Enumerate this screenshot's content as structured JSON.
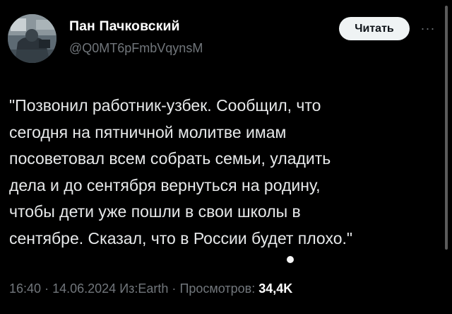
{
  "author": {
    "display_name": "Пан Пачковский",
    "handle": "@Q0MT6pFmbVqynsM",
    "avatar_icon": "profile-photo"
  },
  "actions": {
    "follow_label": "Читать",
    "more_label": "···"
  },
  "tweet": {
    "lines": [
      "\"Позвонил работник-узбек. Сообщил, что",
      "сегодня на пятничной молитве имам",
      "посоветовал всем собрать семьи, уладить",
      "дела и до сентября вернуться на родину,",
      "чтобы дети уже пошли в свои школы в",
      "сентябре. Сказал, что в России будет плохо.\""
    ]
  },
  "meta": {
    "time": "16:40",
    "separator": "·",
    "date": "14.06.2024",
    "source": "Из:Earth",
    "views_label": "Просмотров:",
    "views_count": "34,4K"
  },
  "colors": {
    "background": "#000000",
    "text": "#e7e9ea",
    "secondary": "#71767b",
    "button_bg": "#eff3f4"
  }
}
